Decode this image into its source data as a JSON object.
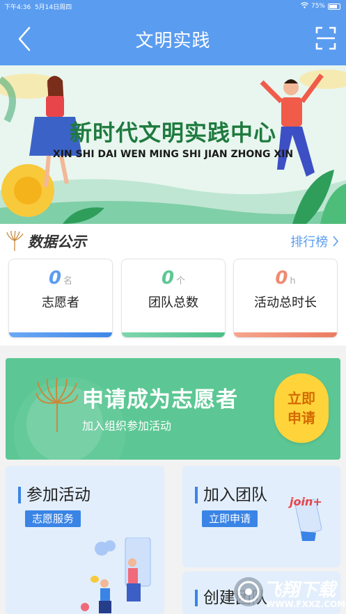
{
  "status_bar": {
    "time": "下午4:36",
    "date": "5月14日周四",
    "battery": "75%"
  },
  "nav": {
    "title": "文明实践",
    "back_icon": "chevron-left-icon",
    "scan_icon": "scan-icon"
  },
  "banner": {
    "title": "新时代文明实践中心",
    "pinyin": "XIN SHI DAI WEN MING SHI JIAN ZHONG XIN"
  },
  "data_section": {
    "title": "数据公示",
    "ranking_link": "排行榜",
    "stats": [
      {
        "value": "0",
        "unit": "名",
        "label": "志愿者",
        "color": "#5a9cf0"
      },
      {
        "value": "0",
        "unit": "个",
        "label": "团队总数",
        "color": "#5cc794"
      },
      {
        "value": "0",
        "unit": "h",
        "label": "活动总时长",
        "color": "#f08a72"
      }
    ]
  },
  "apply": {
    "title": "申请成为志愿者",
    "subtitle": "加入组织参加活动",
    "button_line1": "立即",
    "button_line2": "申请"
  },
  "cards": {
    "activity": {
      "title": "参加活动",
      "tag": "志愿服务"
    },
    "team": {
      "title": "加入团队",
      "tag": "立即申请",
      "badge": "join+"
    },
    "create": {
      "title": "创建团队"
    }
  },
  "watermark": {
    "text": "飞翔下载",
    "url": "WWW.FXXZ.COM"
  },
  "colors": {
    "primary": "#5a9cf0",
    "accent_green": "#5cc794",
    "accent_orange": "#f08a72",
    "tag_blue": "#3a84e6"
  }
}
